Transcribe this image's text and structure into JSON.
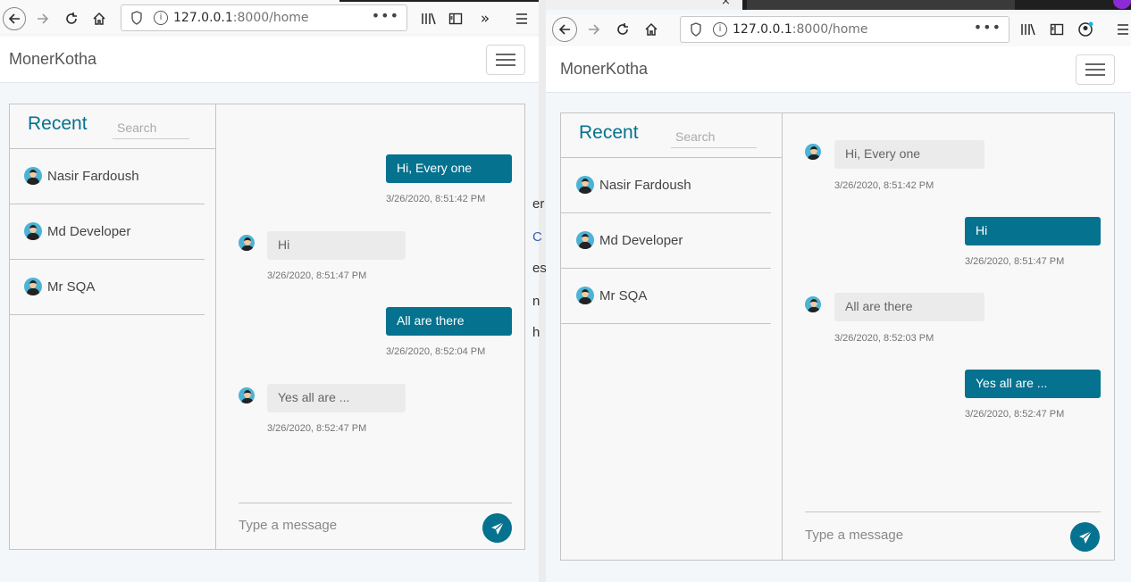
{
  "left_window": {
    "url_host": "127.0.0.1",
    "url_rest": ":8000/home",
    "brand": "MonerKotha",
    "inbox_title": "Recent",
    "search_placeholder": "Search",
    "contacts": [
      {
        "name": "Nasir Fardoush"
      },
      {
        "name": "Md Developer"
      },
      {
        "name": "Mr SQA"
      }
    ],
    "messages": [
      {
        "direction": "outgoing",
        "text": "Hi, Every one",
        "time": "3/26/2020, 8:51:42 PM"
      },
      {
        "direction": "incoming",
        "text": "Hi",
        "time": "3/26/2020, 8:51:47 PM"
      },
      {
        "direction": "outgoing",
        "text": "All are there",
        "time": "3/26/2020, 8:52:04 PM"
      },
      {
        "direction": "incoming",
        "text": "Yes all are ...",
        "time": "3/26/2020, 8:52:47 PM"
      }
    ],
    "type_placeholder": "Type a message"
  },
  "right_window": {
    "url_host": "127.0.0.1",
    "url_rest": ":8000/home",
    "brand": "MonerKotha",
    "inbox_title": "Recent",
    "search_placeholder": "Search",
    "contacts": [
      {
        "name": "Nasir Fardoush"
      },
      {
        "name": "Md Developer"
      },
      {
        "name": "Mr SQA"
      }
    ],
    "messages": [
      {
        "direction": "incoming",
        "text": "Hi, Every one",
        "time": "3/26/2020, 8:51:42 PM"
      },
      {
        "direction": "outgoing",
        "text": "Hi",
        "time": "3/26/2020, 8:51:47 PM"
      },
      {
        "direction": "incoming",
        "text": "All are there",
        "time": "3/26/2020, 8:52:03 PM"
      },
      {
        "direction": "outgoing",
        "text": "Yes all are ...",
        "time": "3/26/2020, 8:52:47 PM"
      }
    ],
    "type_placeholder": "Type a message"
  },
  "background_fragments": [
    "er",
    "C",
    "es",
    "n",
    "h"
  ],
  "colors": {
    "accent": "#05728f",
    "incoming_bubble": "#ebebeb",
    "page_bg": "#f4f7fa"
  },
  "icons": {
    "back": "back-arrow-icon",
    "forward": "forward-arrow-icon",
    "reload": "reload-icon",
    "home": "home-icon",
    "library": "library-icon",
    "sidebar": "sidebar-icon",
    "overflow": "overflow-chevrons-icon",
    "menu": "hamburger-menu-icon",
    "account": "account-icon",
    "send": "paper-plane-icon"
  }
}
